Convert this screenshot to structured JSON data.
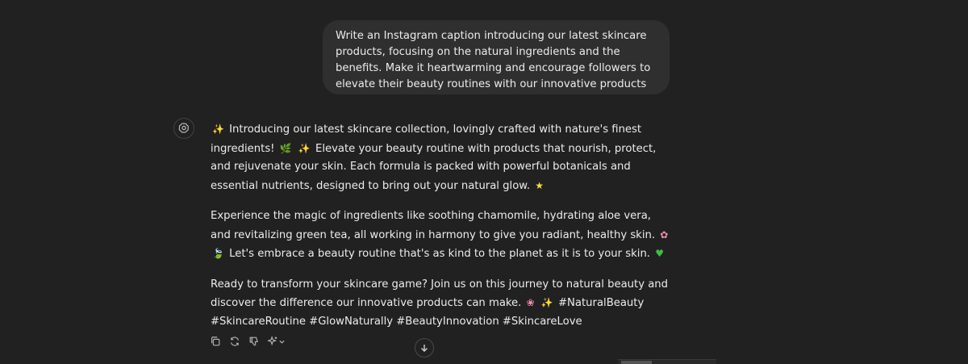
{
  "user_message": {
    "text": "Write an Instagram caption introducing our latest skincare products, focusing on the natural ingredients and the benefits. Make it heartwarming and encourage followers to elevate their beauty routines with our innovative products"
  },
  "assistant_message": {
    "p1_a": "Introducing our latest skincare collection, lovingly crafted with nature's finest ingredients!",
    "p1_b": "Elevate your beauty routine with products that nourish, protect, and rejuvenate your skin. Each formula is packed with powerful botanicals and essential nutrients, designed to bring out your natural glow.",
    "p2_a": "Experience the magic of ingredients like soothing chamomile, hydrating aloe vera, and revitalizing green tea, all working in harmony to give you radiant, healthy skin.",
    "p2_b": "Let's embrace a beauty routine that's as kind to the planet as it is to your skin.",
    "p3_a": "Ready to transform your skincare game? Join us on this journey to natural beauty and discover the difference our innovative products can make.",
    "p3_b": "#NaturalBeauty #SkincareRoutine #GlowNaturally #BeautyInnovation #SkincareLove"
  },
  "emojis": {
    "sparkles": "✨",
    "herb": "🌿",
    "star": "★",
    "cherry_blossom": "✿",
    "leaf": "🍃",
    "green_heart": "♥",
    "hibiscus": "❀"
  },
  "icons": {
    "avatar": "openai-logo-icon",
    "copy": "copy-icon",
    "regenerate": "regenerate-icon",
    "thumbs_down": "thumbs-down-icon",
    "model": "sparkle-model-icon",
    "chevron": "chevron-down-icon",
    "scroll": "arrow-down-icon"
  },
  "colors": {
    "background": "#212121",
    "user_bubble": "#2f2f2f",
    "text": "#ececec",
    "icon": "#b4b4b4"
  }
}
